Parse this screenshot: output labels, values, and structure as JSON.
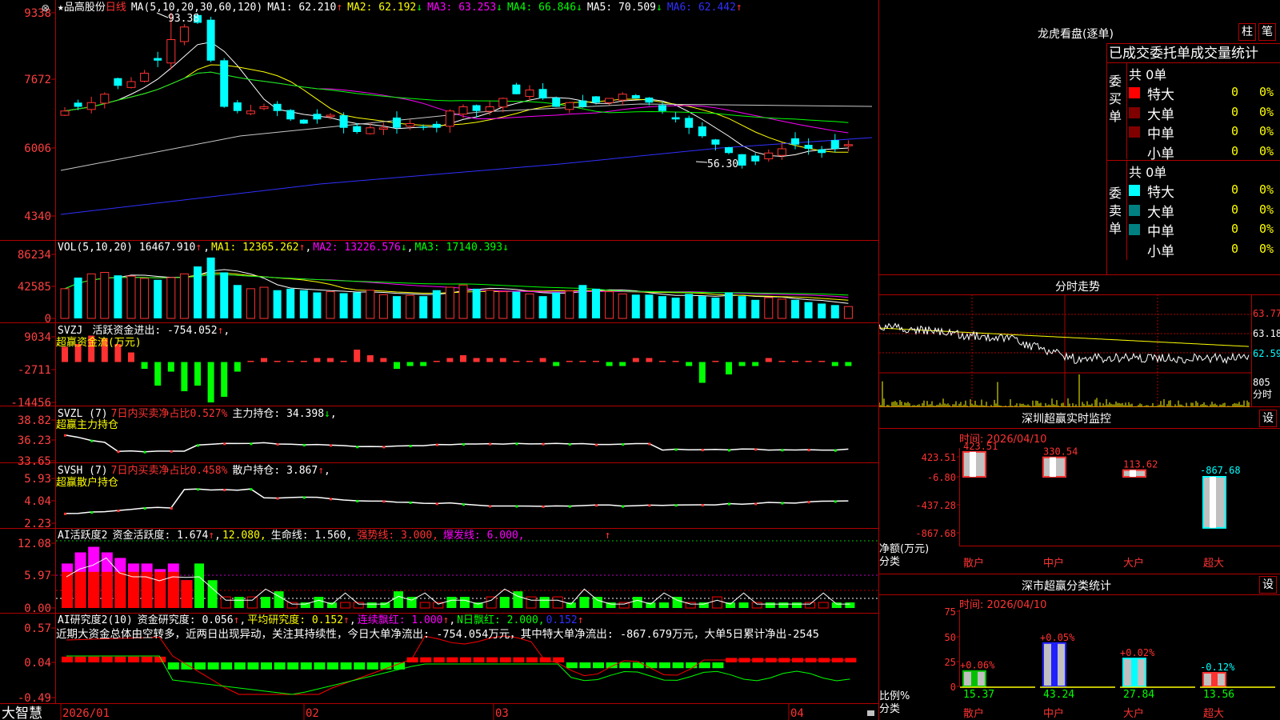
{
  "stock": {
    "name": "★品高股份",
    "period": "日线"
  },
  "main_panel": {
    "ma_label": "MA(5,10,20,30,60,120)",
    "ma1": "MA1: 62.210",
    "ma2": "MA2: 62.192",
    "ma3": "MA3: 63.253",
    "ma4": "MA4: 66.846",
    "ma5": "MA5: 70.509",
    "ma6": "MA6: 62.442",
    "y_ticks": [
      "9338",
      "7672",
      "6006",
      "4340"
    ],
    "high_label": "93.38",
    "low_label": "56.30"
  },
  "vol_panel": {
    "label": "VOL(5,10,20)",
    "value": "16467.910",
    "ma1": "MA1: 12365.262",
    "ma2": "MA2: 13226.576",
    "ma3": "MA3: 17140.393",
    "y_ticks": [
      "86234",
      "42585",
      "0"
    ]
  },
  "svzj_panel": {
    "label": "SVZJ",
    "text1": "活跃资金进出: -754.052",
    "text2": "超赢资金流(万元)",
    "y_ticks": [
      "9034",
      "-2711",
      "-14456"
    ]
  },
  "svzl_panel": {
    "label": "SVZL (7)",
    "text1": "7日内买卖净占比0.527%",
    "text2": "主力持仓: 34.398",
    "text3": "超赢主力持仓",
    "y_ticks": [
      "38.82",
      "36.23",
      "33.65"
    ]
  },
  "svsh_panel": {
    "label": "SVSH (7)",
    "text1": "7日内买卖净占比0.458%",
    "text2": "散户持仓: 3.867",
    "text3": "超赢散户持仓",
    "y_ticks": [
      "5.93",
      "4.04",
      "2.23"
    ]
  },
  "ai_active_panel": {
    "label": "AI活跃度2",
    "text1": "资金活跃度: 1.674",
    "text2": "12.080,",
    "text3": "生命线: 1.560,",
    "text4": "强势线: 3.000,",
    "text5": "爆发线: 6.000,",
    "y_ticks": [
      "12.08",
      "5.97",
      "0.00"
    ]
  },
  "ai_research_panel": {
    "label": "AI研究度2(10)",
    "text1": "资金研究度: 0.056",
    "text2": "平均研究度: 0.152",
    "text3": "连续飘红: 1.000",
    "text4": "N日飘红: 2.000,",
    "text5": "0.152",
    "comment": "近期大资金总体由空转多，近两日出现异动，关注其持续性，今日大单净流出: -754.054万元，其中特大单净流出: -867.679万元，大单5日累计净出-2545",
    "y_ticks": [
      "0.57",
      "0.04",
      "-0.49"
    ]
  },
  "bottom_bar": {
    "brand": "大智慧",
    "dates": [
      "2026/01",
      "02",
      "03",
      "04"
    ]
  },
  "dragon_tiger": {
    "title": "龙虎看盘(逐单)",
    "btn_zhu": "柱",
    "btn_bi": "笔",
    "tabs": "已成交委托单成交量统计",
    "buy_label": "委买单",
    "sell_label": "委卖单",
    "buy_total": "共 0单",
    "sell_total": "共 0单",
    "rows": [
      "特大",
      "大单",
      "中单",
      "小单"
    ],
    "zero": "0",
    "pct": "0%"
  },
  "intraday": {
    "title": "分时走势",
    "y_ticks": [
      "63.77",
      "63.18",
      "62.59"
    ],
    "vol_tick": "805",
    "unit": "分时"
  },
  "monitor": {
    "title": "深圳超赢实时监控",
    "set_btn": "设",
    "time": "时间: 2026/04/10",
    "y_ticks": [
      "423.51",
      "-6.80",
      "-437.28",
      "-867.68"
    ],
    "bars": [
      {
        "label": "散户",
        "value": "423.51"
      },
      {
        "label": "中户",
        "value": "330.54"
      },
      {
        "label": "大户",
        "value": "113.62"
      },
      {
        "label": "超大",
        "value": "-867.68"
      }
    ],
    "axis_label1": "净额(万元)",
    "axis_label2": "分类"
  },
  "classify": {
    "title": "深市超赢分类统计",
    "set_btn": "设",
    "time": "时间: 2026/04/10",
    "y_ticks": [
      "75",
      "50",
      "25",
      "0"
    ],
    "bars": [
      {
        "label": "散户",
        "pct": "+0.06%",
        "value": "15.37"
      },
      {
        "label": "中户",
        "pct": "+0.05%",
        "value": "43.24"
      },
      {
        "label": "大户",
        "pct": "+0.02%",
        "value": "27.84"
      },
      {
        "label": "超大",
        "pct": "-0.12%",
        "value": "13.56"
      }
    ],
    "axis_label1": "比例%",
    "axis_label2": "分类"
  },
  "colors": {
    "up": "#ff3232",
    "down": "#00ffff",
    "grid": "#b00000",
    "ma1": "#ffffff",
    "ma2": "#ffff00",
    "ma3": "#ff00ff",
    "ma4": "#00ff00",
    "ma5": "#c8c8c8",
    "ma6": "#3030ff"
  }
}
